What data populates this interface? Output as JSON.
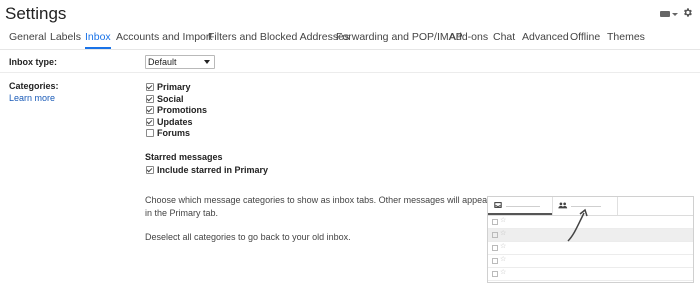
{
  "header": {
    "title": "Settings",
    "icons": [
      "keyboard-icon",
      "gear-icon"
    ]
  },
  "tabs": [
    {
      "label": "General",
      "active": false
    },
    {
      "label": "Labels",
      "active": false
    },
    {
      "label": "Inbox",
      "active": true
    },
    {
      "label": "Accounts and Import",
      "active": false
    },
    {
      "label": "Filters and Blocked Addresses",
      "active": false
    },
    {
      "label": "Forwarding and POP/IMAP",
      "active": false
    },
    {
      "label": "Add-ons",
      "active": false
    },
    {
      "label": "Chat",
      "active": false
    },
    {
      "label": "Advanced",
      "active": false
    },
    {
      "label": "Offline",
      "active": false
    },
    {
      "label": "Themes",
      "active": false
    }
  ],
  "inbox_type": {
    "label": "Inbox type:",
    "selected": "Default"
  },
  "categories": {
    "label": "Categories:",
    "learn_more": "Learn more",
    "items": [
      {
        "label": "Primary",
        "checked": true
      },
      {
        "label": "Social",
        "checked": true
      },
      {
        "label": "Promotions",
        "checked": true
      },
      {
        "label": "Updates",
        "checked": true
      },
      {
        "label": "Forums",
        "checked": false
      }
    ],
    "starred_heading": "Starred messages",
    "starred_option": {
      "label": "Include starred in Primary",
      "checked": true
    },
    "description_line1": "Choose which message categories to show as inbox tabs. Other messages will appear",
    "description_line2": "in the Primary tab.",
    "deselect_text": "Deselect all categories to go back to your old inbox."
  },
  "colors": {
    "accent": "#1a73e8",
    "link": "#1a5bb8"
  }
}
